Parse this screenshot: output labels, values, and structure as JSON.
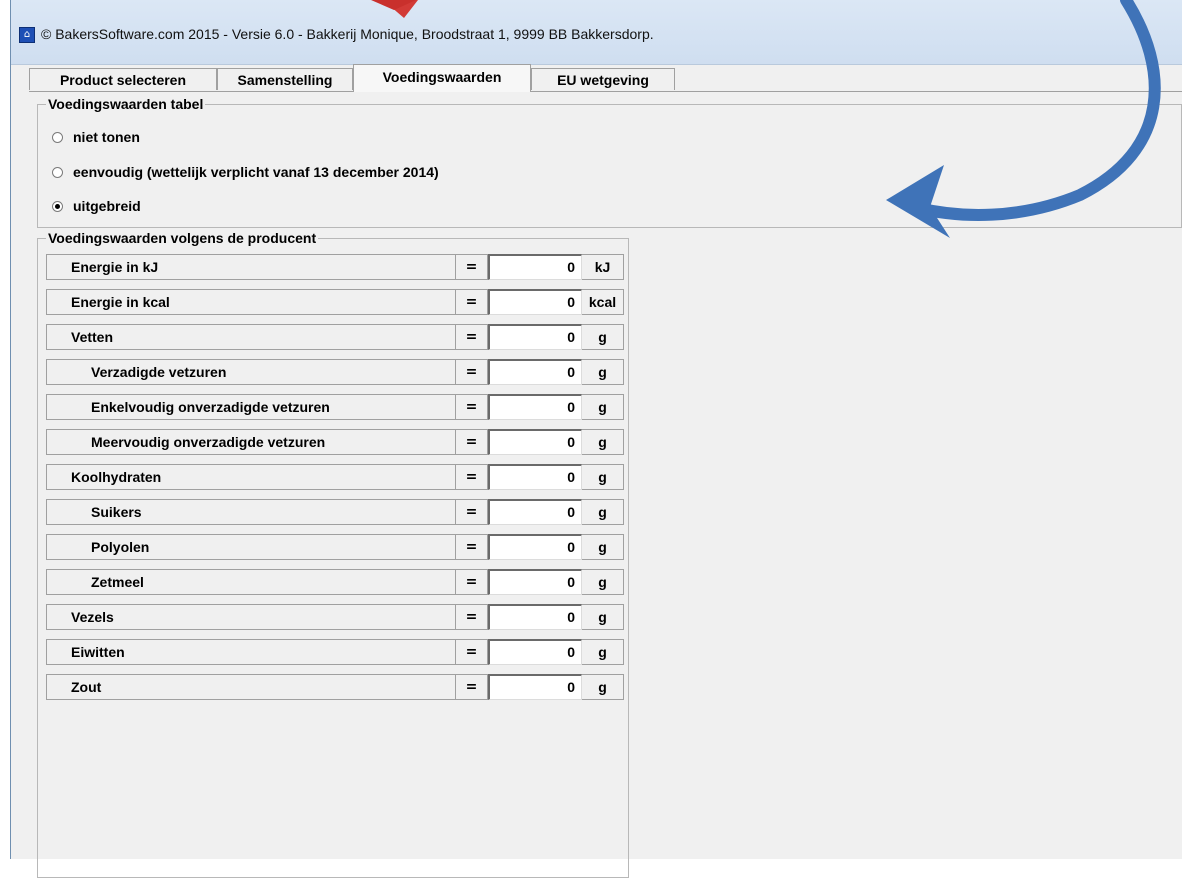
{
  "window": {
    "title": "© BakersSoftware.com 2015 - Versie 6.0 - Bakkerij Monique, Broodstraat 1, 9999 BB Bakkersdorp."
  },
  "tabs": [
    {
      "label": "Product selecteren",
      "active": false
    },
    {
      "label": "Samenstelling",
      "active": false
    },
    {
      "label": "Voedingswaarden",
      "active": true
    },
    {
      "label": "EU wetgeving",
      "active": false
    }
  ],
  "table_group": {
    "title": "Voedingswaarden tabel",
    "options": [
      {
        "label": "niet tonen",
        "checked": false
      },
      {
        "label": "eenvoudig (wettelijk verplicht vanaf 13 december 2014)",
        "checked": false
      },
      {
        "label": "uitgebreid",
        "checked": true
      }
    ]
  },
  "producer_group": {
    "title": "Voedingswaarden volgens de producent",
    "rows": [
      {
        "label": "Energie in kJ",
        "eq": "=",
        "value": "0",
        "unit": "kJ",
        "indent": 0
      },
      {
        "label": "Energie in kcal",
        "eq": "=",
        "value": "0",
        "unit": "kcal",
        "indent": 0
      },
      {
        "label": "Vetten",
        "eq": "=",
        "value": "0",
        "unit": "g",
        "indent": 0
      },
      {
        "label": "Verzadigde vetzuren",
        "eq": "=",
        "value": "0",
        "unit": "g",
        "indent": 1
      },
      {
        "label": "Enkelvoudig onverzadigde vetzuren",
        "eq": "=",
        "value": "0",
        "unit": "g",
        "indent": 1
      },
      {
        "label": "Meervoudig onverzadigde vetzuren",
        "eq": "=",
        "value": "0",
        "unit": "g",
        "indent": 1
      },
      {
        "label": "Koolhydraten",
        "eq": "=",
        "value": "0",
        "unit": "g",
        "indent": 0
      },
      {
        "label": "Suikers",
        "eq": "=",
        "value": "0",
        "unit": "g",
        "indent": 1
      },
      {
        "label": "Polyolen",
        "eq": "=",
        "value": "0",
        "unit": "g",
        "indent": 1
      },
      {
        "label": "Zetmeel",
        "eq": "=",
        "value": "0",
        "unit": "g",
        "indent": 1
      },
      {
        "label": "Vezels",
        "eq": "=",
        "value": "0",
        "unit": "g",
        "indent": 0
      },
      {
        "label": "Eiwitten",
        "eq": "=",
        "value": "0",
        "unit": "g",
        "indent": 0
      },
      {
        "label": "Zout",
        "eq": "=",
        "value": "0",
        "unit": "g",
        "indent": 0
      }
    ]
  },
  "annotations": {
    "red_arrow_color": "#d23a36",
    "blue_arrow_color": "#3f73b8"
  }
}
